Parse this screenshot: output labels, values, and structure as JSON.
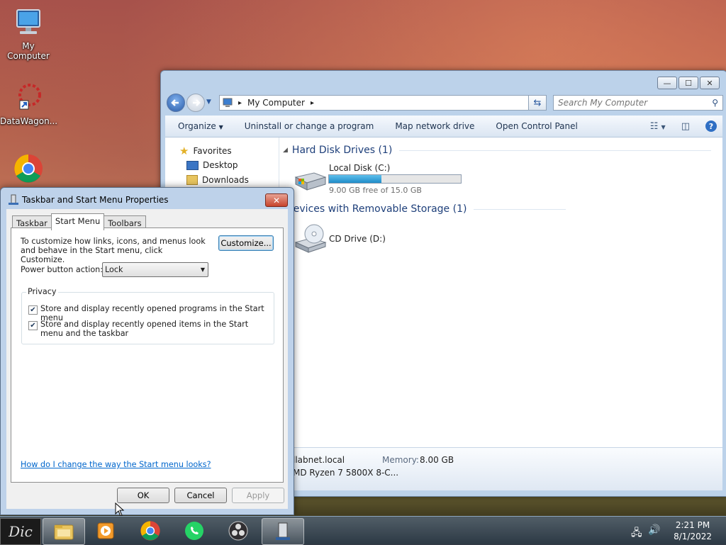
{
  "desktop": {
    "icons": [
      {
        "label": "My Computer"
      },
      {
        "label": "DataWagon..."
      }
    ]
  },
  "explorer": {
    "window_controls": {
      "minimize": "—",
      "maximize": "☐",
      "close": "✕"
    },
    "address": {
      "root_arrow": "▸",
      "location": "My Computer",
      "trail_arrow": "▸"
    },
    "search": {
      "placeholder": "Search My Computer"
    },
    "commands": {
      "organize": "Organize",
      "uninstall": "Uninstall or change a program",
      "map_drive": "Map network drive",
      "control_panel": "Open Control Panel"
    },
    "nav": {
      "favorites": "Favorites",
      "desktop": "Desktop",
      "downloads": "Downloads"
    },
    "groups": {
      "hard_disk": "Hard Disk Drives (1)",
      "removable": "Devices with Removable Storage (1)"
    },
    "drives": {
      "local_disk": {
        "name": "Local Disk (C:)",
        "free_text": "9.00 GB free of 15.0 GB",
        "used_fraction": 0.4
      },
      "cd_drive": {
        "name": "CD Drive (D:)"
      }
    },
    "details": {
      "domain": "llabnet.local",
      "memory_label": "Memory:",
      "memory_value": "8.00 GB",
      "processor": "MD Ryzen 7 5800X 8-C..."
    }
  },
  "dialog": {
    "title": "Taskbar and Start Menu Properties",
    "close": "✕",
    "tabs": [
      "Taskbar",
      "Start Menu",
      "Toolbars"
    ],
    "description": "To customize how links, icons, and menus look and behave in the Start menu, click Customize.",
    "customize_button": "Customize...",
    "power_label": "Power button action:",
    "power_value": "Lock",
    "privacy_legend": "Privacy",
    "privacy_options": [
      {
        "label": "Store and display recently opened programs in the Start menu",
        "checked": true
      },
      {
        "label": "Store and display recently opened items in the Start menu and the taskbar",
        "checked": true
      }
    ],
    "help_link": "How do I change the way the Start menu looks?",
    "buttons": {
      "ok": "OK",
      "cancel": "Cancel",
      "apply": "Apply"
    }
  },
  "taskbar": {
    "clock": {
      "time": "2:21 PM",
      "date": "8/1/2022"
    }
  },
  "colors": {
    "accent_link": "#0066cc",
    "group_header": "#1e3f7a",
    "drive_bar": "#26a0da"
  }
}
